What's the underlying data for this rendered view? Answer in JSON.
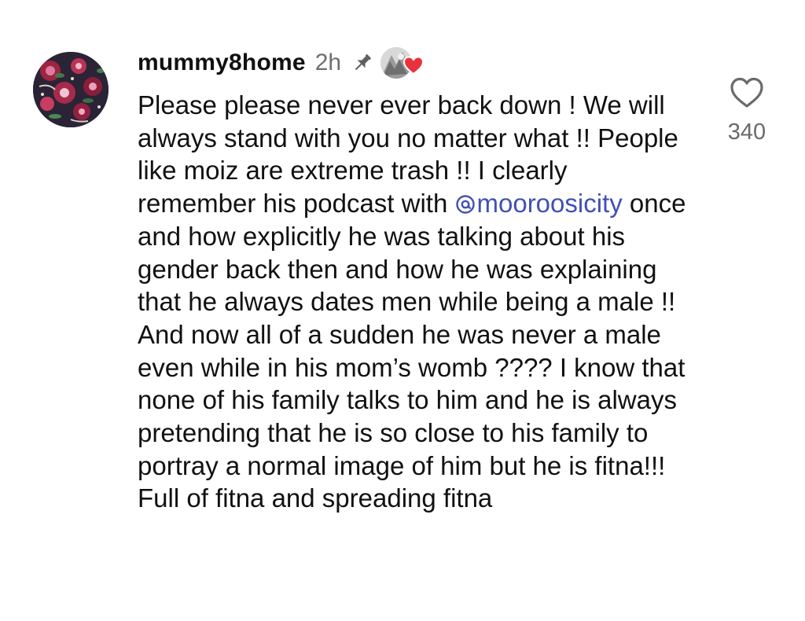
{
  "comment": {
    "username": "mummy8home",
    "time": "2h",
    "pinned_icon": "pin-icon",
    "creator_liked_icon": "heart-icon",
    "text_before_mention": "Please please never ever back down ! We will always stand with you no matter what !! People like moiz are extreme trash !! I clearly remember his podcast with ",
    "mention": "mooroosicity",
    "mention_icon": "threads-icon",
    "text_after_mention": " once and how explicitly he was talking about his gender back then and how he was explaining that he always dates men while being a male !! And now all of a sudden he was never a male even while in his mom’s womb ???? I know that none of his family talks to him and he is always pretending that he is so close to his family to portray a normal image of him but he is fitna!!! Full of fitna and spreading fitna",
    "like_icon": "heart-outline-icon",
    "like_count": "340"
  },
  "colors": {
    "mention": "#4150b5",
    "heart_red": "#e8323c",
    "muted_text": "#6e6e6e"
  }
}
